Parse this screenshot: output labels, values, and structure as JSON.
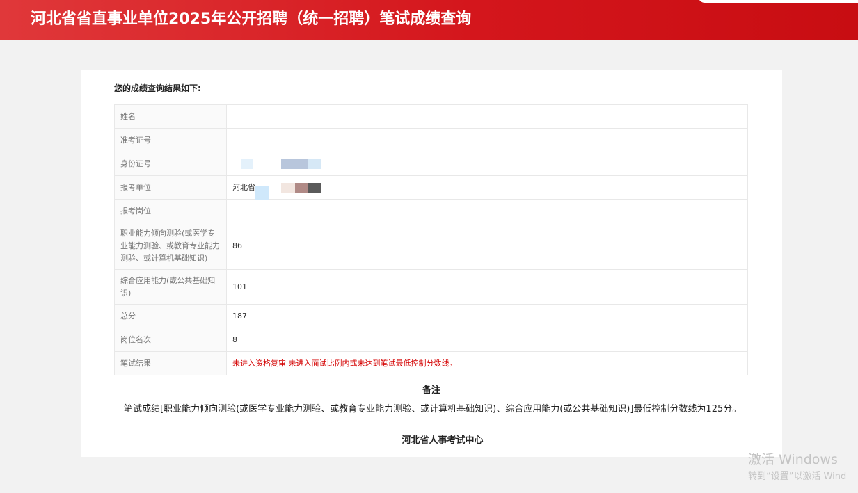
{
  "header": {
    "title": "河北省省直事业单位2025年公开招聘（统一招聘）笔试成绩查询"
  },
  "result": {
    "heading": "您的成绩查询结果如下:",
    "rows": [
      {
        "label": "姓名",
        "value": ""
      },
      {
        "label": "准考证号",
        "value": ""
      },
      {
        "label": "身份证号",
        "value": ""
      },
      {
        "label": "报考单位",
        "value": "河北省"
      },
      {
        "label": "报考岗位",
        "value": ""
      },
      {
        "label": "职业能力倾向测验(或医学专业能力测验、或教育专业能力测验、或计算机基础知识)",
        "value": "86"
      },
      {
        "label": "综合应用能力(或公共基础知识)",
        "value": "101"
      },
      {
        "label": "总分",
        "value": "187"
      },
      {
        "label": "岗位名次",
        "value": "8"
      },
      {
        "label": "笔试结果",
        "value": "未进入资格复审 未进入面试比例内或未达到笔试最低控制分数线。"
      }
    ]
  },
  "note": {
    "title": "备注",
    "text": "笔试成绩[职业能力倾向测验(或医学专业能力测验、或教育专业能力测验、或计算机基础知识)、综合应用能力(或公共基础知识)]最低控制分数线为125分。"
  },
  "footer": {
    "org": "河北省人事考试中心"
  },
  "watermark": {
    "line1": "激活 Windows",
    "line2": "转到“设置”以激活 Wind"
  },
  "colors": {
    "header_red": "#d4161c",
    "result_red": "#d40000"
  }
}
